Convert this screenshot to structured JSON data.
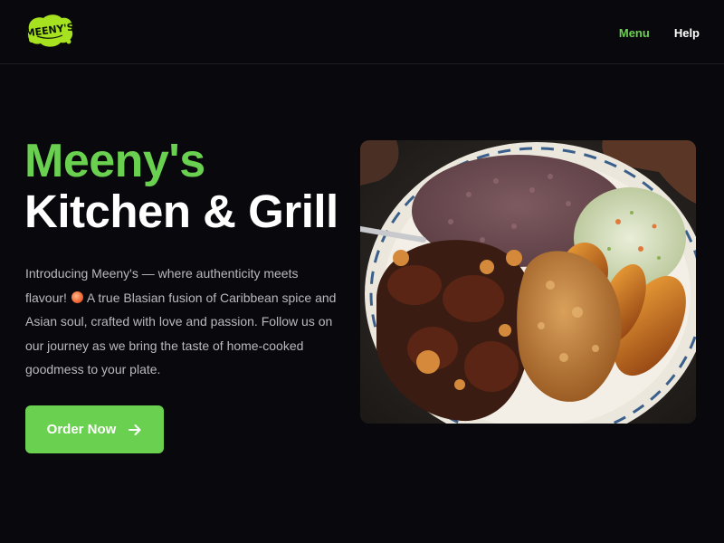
{
  "brand": {
    "logo_text": "Meeny's",
    "colors": {
      "accent": "#6ad04f",
      "background": "#09090d",
      "text_muted": "#b9b9be"
    }
  },
  "nav": {
    "items": [
      {
        "label": "Menu",
        "active": true
      },
      {
        "label": "Help",
        "active": false
      }
    ]
  },
  "hero": {
    "title_line1": "Meeny's",
    "title_line2": "Kitchen & Grill",
    "description_part1": "Introducing Meeny's — where authenticity meets flavour! ",
    "description_emoji": "🍜",
    "description_part2": " A true Blasian fusion of Caribbean spice and Asian soul, crafted with love and passion. Follow us on our journey as we bring the taste of home-cooked goodmess to your plate.",
    "cta_label": "Order Now",
    "cta_icon": "arrow-right-icon",
    "image_subject": "food-plate-image"
  }
}
